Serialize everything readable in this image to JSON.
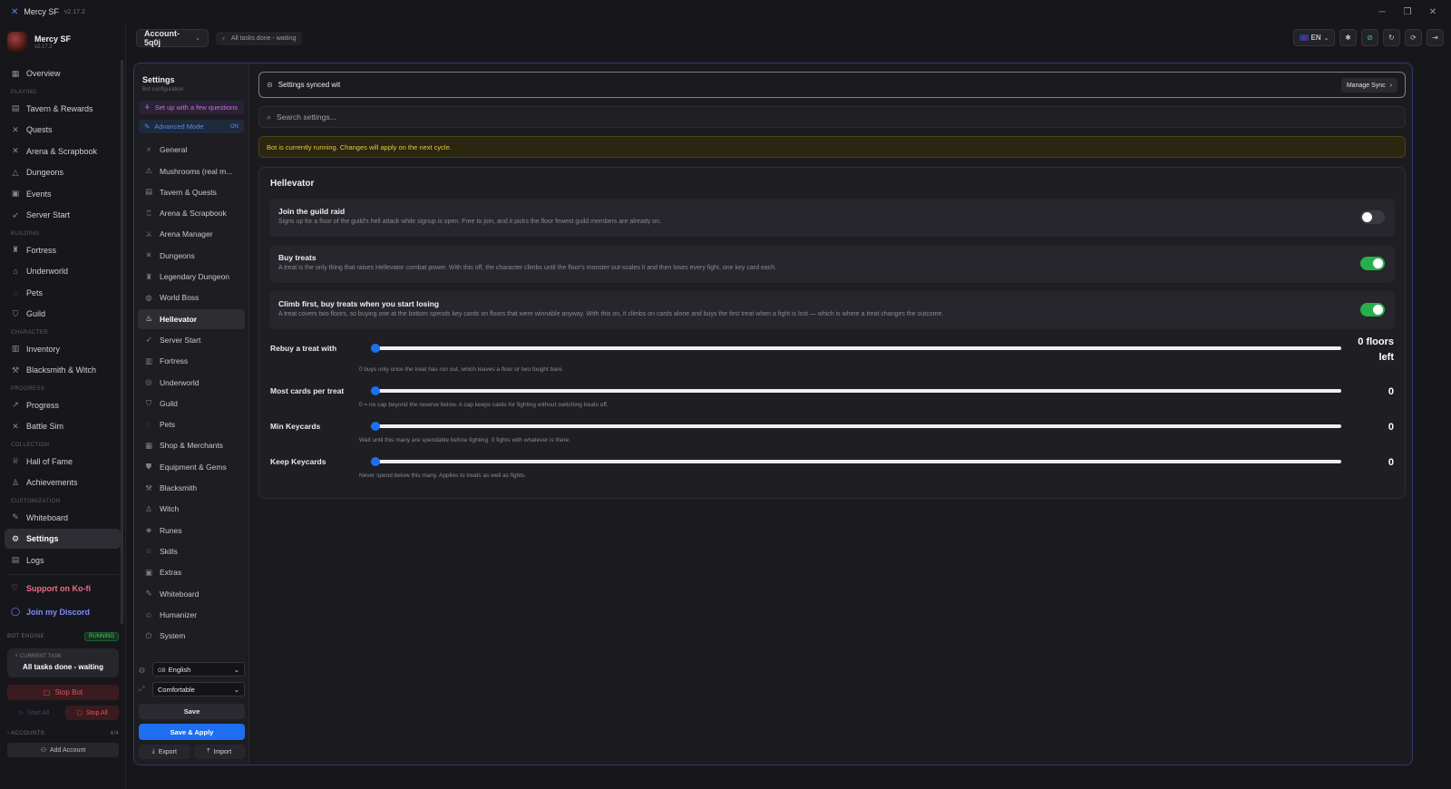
{
  "window": {
    "title": "Mercy SF",
    "version": "v2.17.2",
    "controls": [
      "─",
      "❐",
      "✕"
    ]
  },
  "profile": {
    "name": "Mercy SF",
    "version": "v2.17.2"
  },
  "nav": {
    "overview": "Overview",
    "playing_label": "PLAYING",
    "tavern": "Tavern & Rewards",
    "quests": "Quests",
    "arena": "Arena & Scrapbook",
    "dungeons": "Dungeons",
    "events": "Events",
    "server_start": "Server Start",
    "building_label": "BUILDING",
    "fortress": "Fortress",
    "underworld": "Underworld",
    "pets": "Pets",
    "guild": "Guild",
    "character_label": "CHARACTER",
    "inventory": "Inventory",
    "blacksmith": "Blacksmith & Witch",
    "progress_label": "PROGRESS",
    "progress": "Progress",
    "battle_sim": "Battle Sim",
    "collection_label": "COLLECTION",
    "hall_of_fame": "Hall of Fame",
    "achievements": "Achievements",
    "customization_label": "CUSTOMIZATION",
    "whiteboard": "Whiteboard",
    "settings": "Settings",
    "logs": "Logs",
    "kofi": "Support on Ko-fi",
    "discord": "Join my Discord"
  },
  "engine": {
    "label": "BOT ENGINE",
    "status": "RUNNING",
    "task_label": "CURRENT TASK",
    "task_value": "All tasks done - waiting",
    "stop_bot": "Stop Bot",
    "start_all": "Start All",
    "stop_all": "Stop All",
    "accounts_label": "ACCOUNTS",
    "accounts_count": "4/4",
    "add_account": "Add Account"
  },
  "topbar": {
    "account": "Account-5q0j",
    "status": "All tasks done - waiting",
    "lang": "EN"
  },
  "settings_nav": {
    "title": "Settings",
    "subtitle": "Bot configuration",
    "setup": "Set up with a few questions",
    "advanced": "Advanced Mode",
    "advanced_state": "ON",
    "items": [
      {
        "icon": "⚡",
        "label": "General"
      },
      {
        "icon": "⚠",
        "label": "Mushrooms (real m..."
      },
      {
        "icon": "▤",
        "label": "Tavern & Quests"
      },
      {
        "icon": "♖",
        "label": "Arena & Scrapbook"
      },
      {
        "icon": "⚔",
        "label": "Arena Manager"
      },
      {
        "icon": "✕",
        "label": "Dungeons"
      },
      {
        "icon": "♜",
        "label": "Legendary Dungeon"
      },
      {
        "icon": "◍",
        "label": "World Boss"
      },
      {
        "icon": "♨",
        "label": "Hellevator"
      },
      {
        "icon": "➶",
        "label": "Server Start"
      },
      {
        "icon": "▥",
        "label": "Fortress"
      },
      {
        "icon": "◎",
        "label": "Underworld"
      },
      {
        "icon": "⛉",
        "label": "Guild"
      },
      {
        "icon": "◌",
        "label": "Pets"
      },
      {
        "icon": "▦",
        "label": "Shop & Merchants"
      },
      {
        "icon": "⛊",
        "label": "Equipment & Gems"
      },
      {
        "icon": "⚒",
        "label": "Blacksmith"
      },
      {
        "icon": "♙",
        "label": "Witch"
      },
      {
        "icon": "◈",
        "label": "Runes"
      },
      {
        "icon": "☆",
        "label": "Skills"
      },
      {
        "icon": "▣",
        "label": "Extras"
      },
      {
        "icon": "✎",
        "label": "Whiteboard"
      },
      {
        "icon": "☺",
        "label": "Humanizer"
      },
      {
        "icon": "⏻",
        "label": "System"
      }
    ],
    "language": "English",
    "language_code": "GB",
    "density": "Comfortable",
    "save": "Save",
    "save_apply": "Save & Apply",
    "export": "Export",
    "import": "Import"
  },
  "main": {
    "sync_text": "Settings synced wit",
    "manage_sync": "Manage Sync",
    "search_placeholder": "Search settings...",
    "warning": "Bot is currently running. Changes will apply on the next cycle.",
    "section_title": "Hellevator",
    "toggles": [
      {
        "title": "Join the guild raid",
        "desc": "Signs up for a floor of the guild's hell attack while signup is open. Free to join, and it picks the floor fewest guild members are already on.",
        "on": false
      },
      {
        "title": "Buy treats",
        "desc": "A treat is the only thing that raises Hellevator combat power. With this off, the character climbs until the floor's monster out-scales it and then loses every fight, one key card each.",
        "on": true
      },
      {
        "title": "Climb first, buy treats when you start losing",
        "desc": "A treat covers two floors, so buying one at the bottom spends key cards on floors that were winnable anyway. With this on, it climbs on cards alone and buys the first treat when a fight is lost — which is where a treat changes the outcome.",
        "on": true
      }
    ],
    "sliders": [
      {
        "label": "Rebuy a treat with",
        "value": "0 floors left",
        "value_line1": "0 floors",
        "value_line2": "left",
        "help": "0 buys only once the treat has run out, which leaves a floor or two fought bare.",
        "fraction": 0
      },
      {
        "label": "Most cards per treat",
        "value": "0",
        "help": "0 = no cap beyond the reserve below. A cap keeps cards for fighting without switching treats off.",
        "fraction": 0
      },
      {
        "label": "Min Keycards",
        "value": "0",
        "help": "Wait until this many are spendable before fighting. 0 fights with whatever is there.",
        "fraction": 0
      },
      {
        "label": "Keep Keycards",
        "value": "0",
        "help": "Never spend below this many. Applies to treats as well as fights.",
        "fraction": 0
      }
    ]
  },
  "colors": {
    "accent": "#1e6ff0",
    "toggle_on": "#25b04d",
    "danger": "#e0525e",
    "warning": "#e8c64a"
  }
}
